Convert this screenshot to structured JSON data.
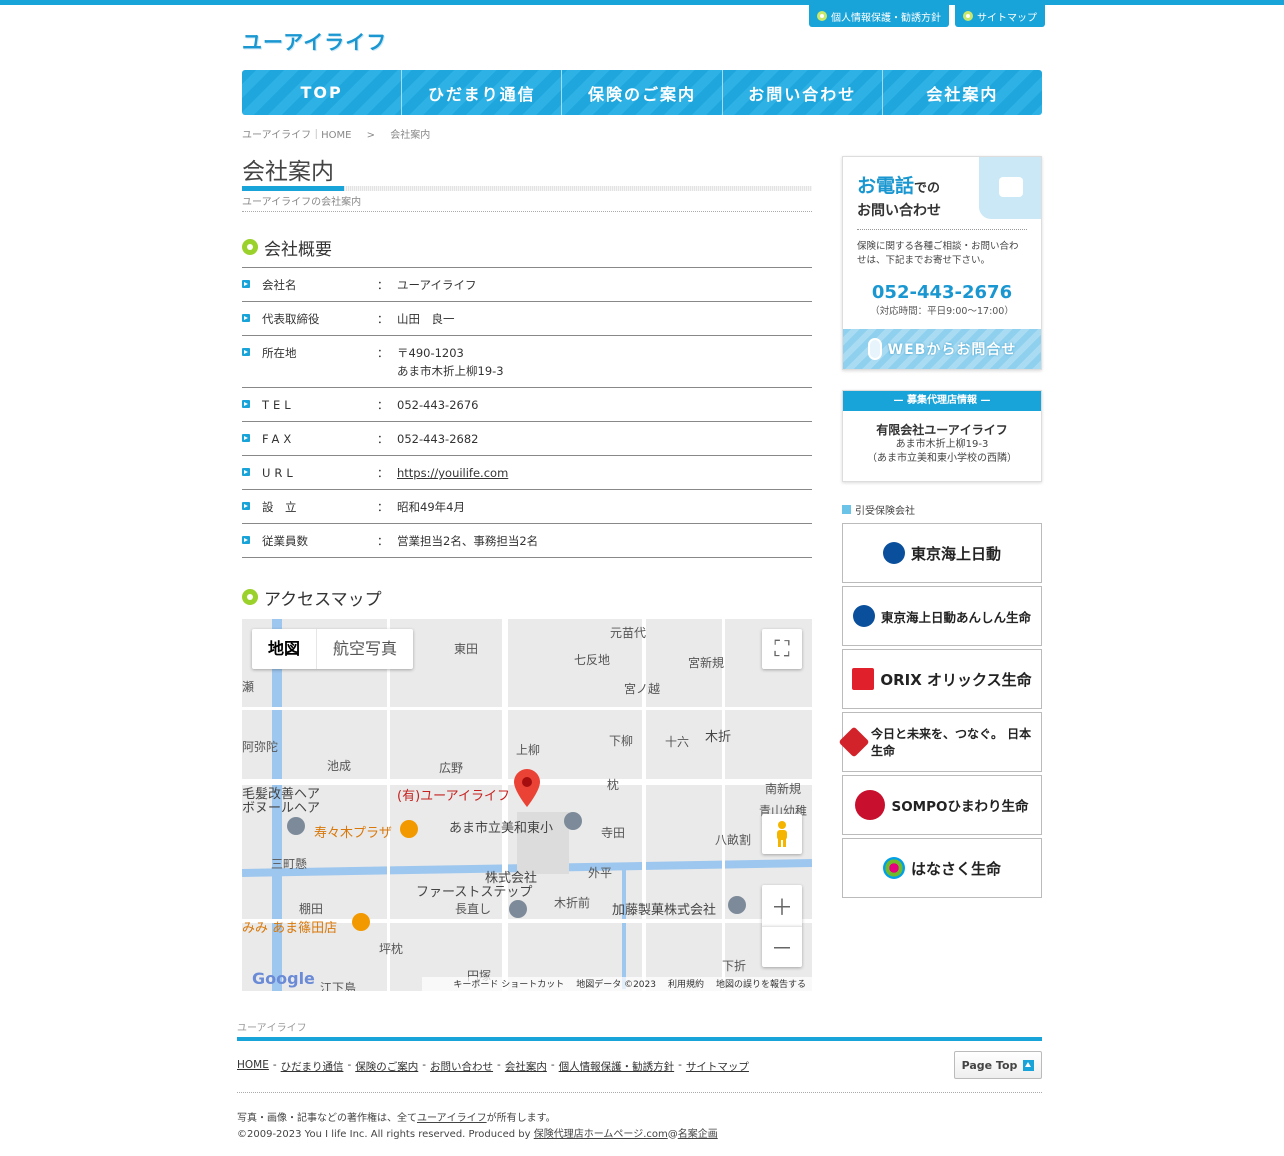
{
  "header": {
    "logo": "ユーアイライフ",
    "toplinks": [
      "個人情報保護・勧誘方針",
      "サイトマップ"
    ]
  },
  "nav": [
    "TOP",
    "ひだまり通信",
    "保険のご案内",
    "お問い合わせ",
    "会社案内"
  ],
  "breadcrumb": [
    "ユーアイライフ｜HOME",
    ">",
    "会社案内"
  ],
  "main": {
    "title": "会社案内",
    "subtitle": "ユーアイライフの会社案内",
    "overview_heading": "会社概要",
    "rows": [
      {
        "label": "会社名",
        "value": "ユーアイライフ"
      },
      {
        "label": "代表取締役",
        "value": "山田　良一"
      },
      {
        "label": "所在地",
        "value": "〒490-1203",
        "value2": "あま市木折上柳19-3"
      },
      {
        "label": "TEL",
        "value": "052-443-2676"
      },
      {
        "label": "FAX",
        "value": "052-443-2682"
      },
      {
        "label": "URL",
        "value": "https://youilife.com"
      },
      {
        "label": "設　立",
        "value": "昭和49年4月"
      },
      {
        "label": "従業員数",
        "value": "営業担当2名、事務担当2名"
      }
    ],
    "colon": "：",
    "access_heading": "アクセスマップ"
  },
  "map": {
    "btn_map": "地図",
    "btn_aerial": "航空写真",
    "labels": [
      "元苗代",
      "東田",
      "七反地",
      "宮新規",
      "宮ノ越",
      "瀬",
      "阿弥陀",
      "池成",
      "広野",
      "上柳",
      "下柳",
      "十六",
      "木折",
      "南新規",
      "枕",
      "青山幼稚",
      "三町懸",
      "毛髪改善ヘア",
      "ボヌールヘア",
      "株式会社",
      "ファーストステップ",
      "外平",
      "寺田",
      "八畝割",
      "棚田",
      "長直し",
      "木折前",
      "坪枕",
      "円塚",
      "下折",
      "江下島"
    ],
    "marker_label": "(有)ユーアイライフ",
    "poi1": "寿々木プラザ",
    "poi2": "あま市立美和東小",
    "poi3": "加藤製菓株式会社",
    "poi4": "みみ あま篠田店",
    "footer": [
      "キーボード ショートカット",
      "地図データ ©2023",
      "利用規約",
      "地図の誤りを報告する"
    ],
    "brand": "Google"
  },
  "sidebar": {
    "tel_title": "お電話",
    "tel_title_small": "での",
    "tel_title2": "お問い合わせ",
    "tel_desc": "保険に関する各種ご相談・お問い合わせは、下記までお寄せ下さい。",
    "tel_number": "052-443-2676",
    "tel_hours": "（対応時間：平日9:00〜17:00）",
    "web_btn": "WEBからお問合せ",
    "agent_head": "— 募集代理店情報 —",
    "agent_name": "有限会社ユーアイライフ",
    "agent_addr1": "あま市木折上柳19-3",
    "agent_addr2": "（あま市立美和東小学校の西隣）",
    "ins_title": "引受保険会社",
    "insurers": [
      {
        "name": "東京海上日動",
        "color": "#0a4f9c"
      },
      {
        "name": "東京海上日動あんしん生命",
        "color": "#0a4f9c"
      },
      {
        "name": "ORIX オリックス生命",
        "color": "#e0202b"
      },
      {
        "name": "今日と未来を、つなぐ。 日本生命",
        "color": "#d2232a"
      },
      {
        "name": "SOMPOひまわり生命",
        "color": "#c8102e"
      },
      {
        "name": "はなさく生命",
        "color": "#e6007e"
      }
    ]
  },
  "footer": {
    "site": "ユーアイライフ",
    "nav": [
      "HOME",
      "ひだまり通信",
      "保険のご案内",
      "お問い合わせ",
      "会社案内",
      "個人情報保護・勧誘方針",
      "サイトマップ"
    ],
    "sep": "-",
    "pagetop": "Page Top",
    "copy1_a": "写真・画像・記事などの著作権は、全て",
    "copy1_link": "ユーアイライフ",
    "copy1_b": "が所有します。",
    "copy2_a": "©2009-2023 You I life Inc. All rights reserved. Produced by ",
    "copy2_link1": "保険代理店ホームページ.com",
    "copy2_at": "@",
    "copy2_link2": "名案企画"
  }
}
